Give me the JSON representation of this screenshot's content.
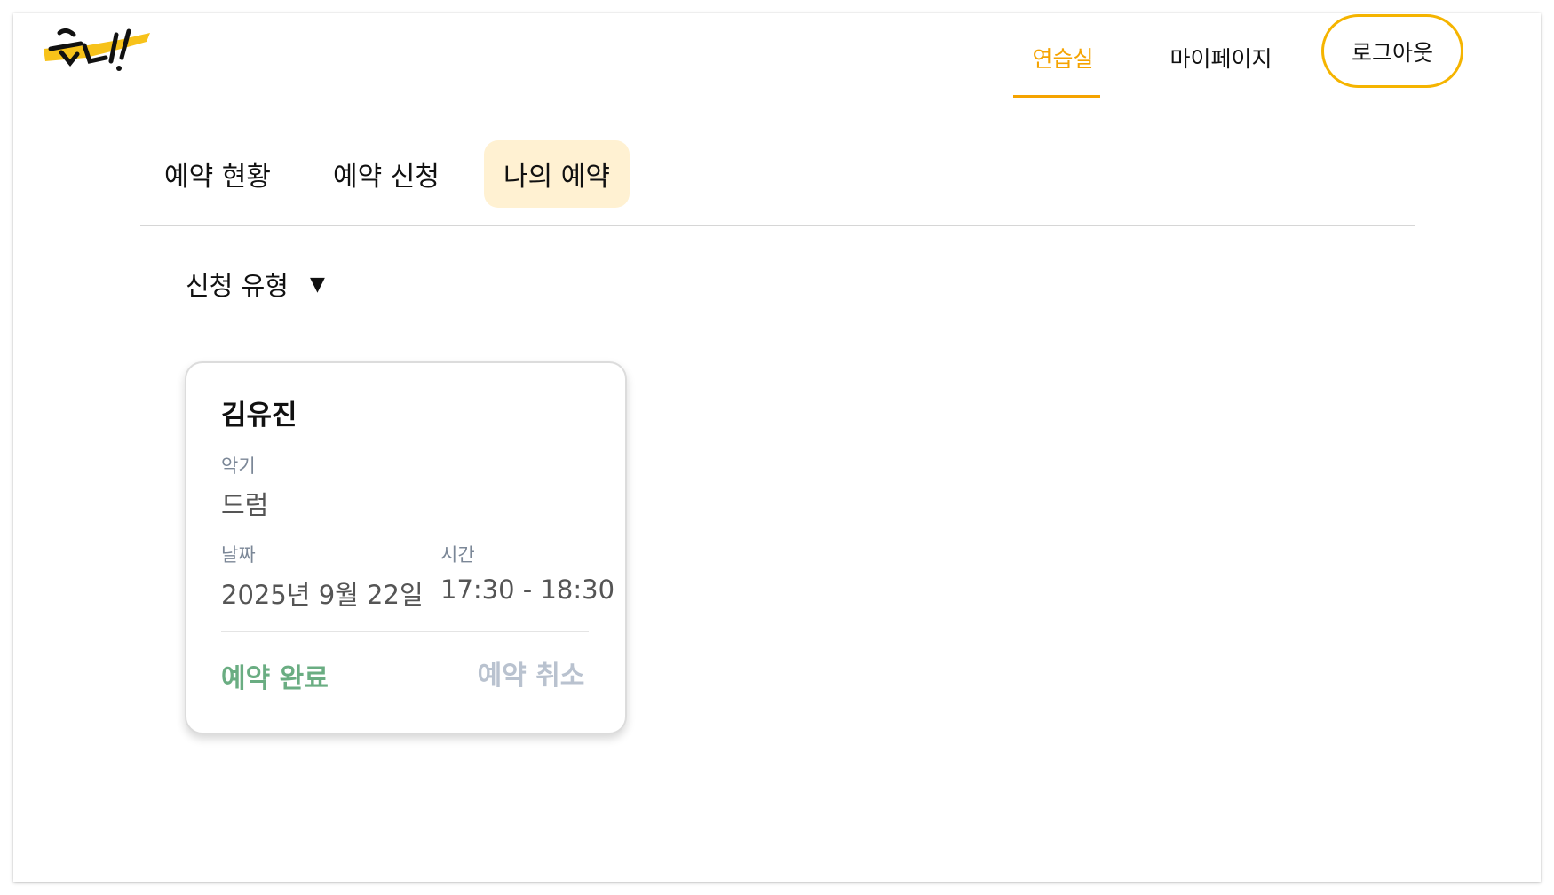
{
  "header": {
    "logo_text": "준비!",
    "nav": {
      "practice_room": "연습실",
      "mypage": "마이페이지"
    },
    "logout_label": "로그아웃"
  },
  "tabs": [
    {
      "label": "예약 현황"
    },
    {
      "label": "예약 신청"
    },
    {
      "label": "나의 예약",
      "active": true
    }
  ],
  "filter": {
    "label": "신청 유형",
    "caret": "▼"
  },
  "reservation": {
    "name": "김유진",
    "instrument_label": "악기",
    "instrument": "드럼",
    "date_label": "날짜",
    "date": "2025년 9월 22일",
    "time_label": "시간",
    "time": "17:30 - 18:30",
    "status": "예약 완료",
    "cancel_label": "예약 취소"
  },
  "colors": {
    "accent": "#f5a300",
    "active_tab_bg": "#fff1d2",
    "status_complete": "#6aad82",
    "cancel_disabled": "#b9c2cf"
  }
}
